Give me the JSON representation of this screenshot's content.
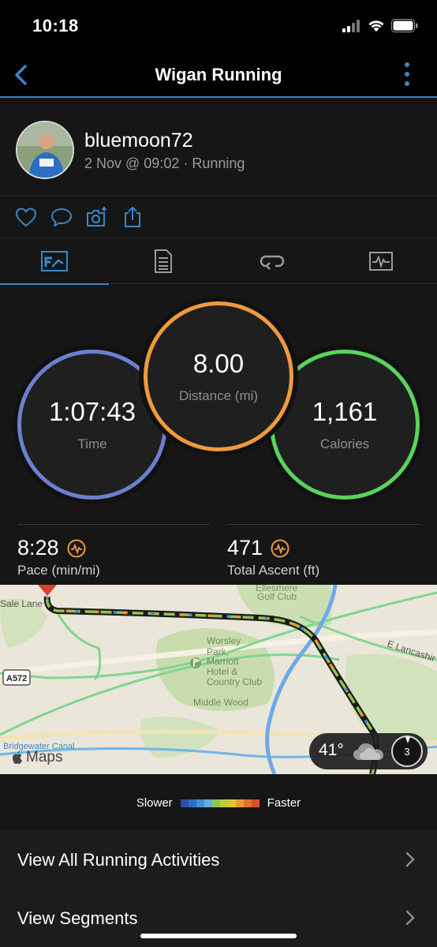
{
  "status_bar": {
    "time": "10:18"
  },
  "nav": {
    "title": "Wigan Running"
  },
  "profile": {
    "username": "bluemoon72",
    "subtitle": "2 Nov @ 09:02 · Running"
  },
  "stats": {
    "distance": {
      "value": "8.00",
      "label": "Distance (mi)",
      "color": "#ef9a3e"
    },
    "time": {
      "value": "1:07:43",
      "label": "Time",
      "color": "#5a8fd6"
    },
    "calories": {
      "value": "1,161",
      "label": "Calories",
      "color": "#5ad35a"
    }
  },
  "metrics": {
    "pace": {
      "value": "8:28",
      "label": "Pace (min/mi)"
    },
    "ascent": {
      "value": "471",
      "label": "Total Ascent (ft)"
    }
  },
  "map": {
    "labels": {
      "sale_lane": "Sale Lane",
      "ellesmere": "Ellesmere",
      "golf_club": "Golf Club",
      "worsley_1": "Worsley",
      "worsley_2": "Park,",
      "worsley_3": "Marriott",
      "worsley_4": "Hotel &",
      "worsley_5": "Country Club",
      "middle_wood": "Middle Wood",
      "lancashire": "E Lancashir",
      "a572": "A572",
      "canal": "Bridgewater Canal"
    },
    "attribution": "Maps",
    "weather": {
      "temp": "41°",
      "wind": "3"
    }
  },
  "legend": {
    "slower": "Slower",
    "faster": "Faster",
    "colors": [
      "#2b4fa6",
      "#2f6cc9",
      "#3d8fd8",
      "#5fb0d9",
      "#8ec64b",
      "#b8d03a",
      "#e6c232",
      "#e89a2f",
      "#e5702b",
      "#d94f2a"
    ]
  },
  "list": {
    "items": [
      {
        "label": "View All Running Activities"
      },
      {
        "label": "View Segments"
      }
    ]
  }
}
